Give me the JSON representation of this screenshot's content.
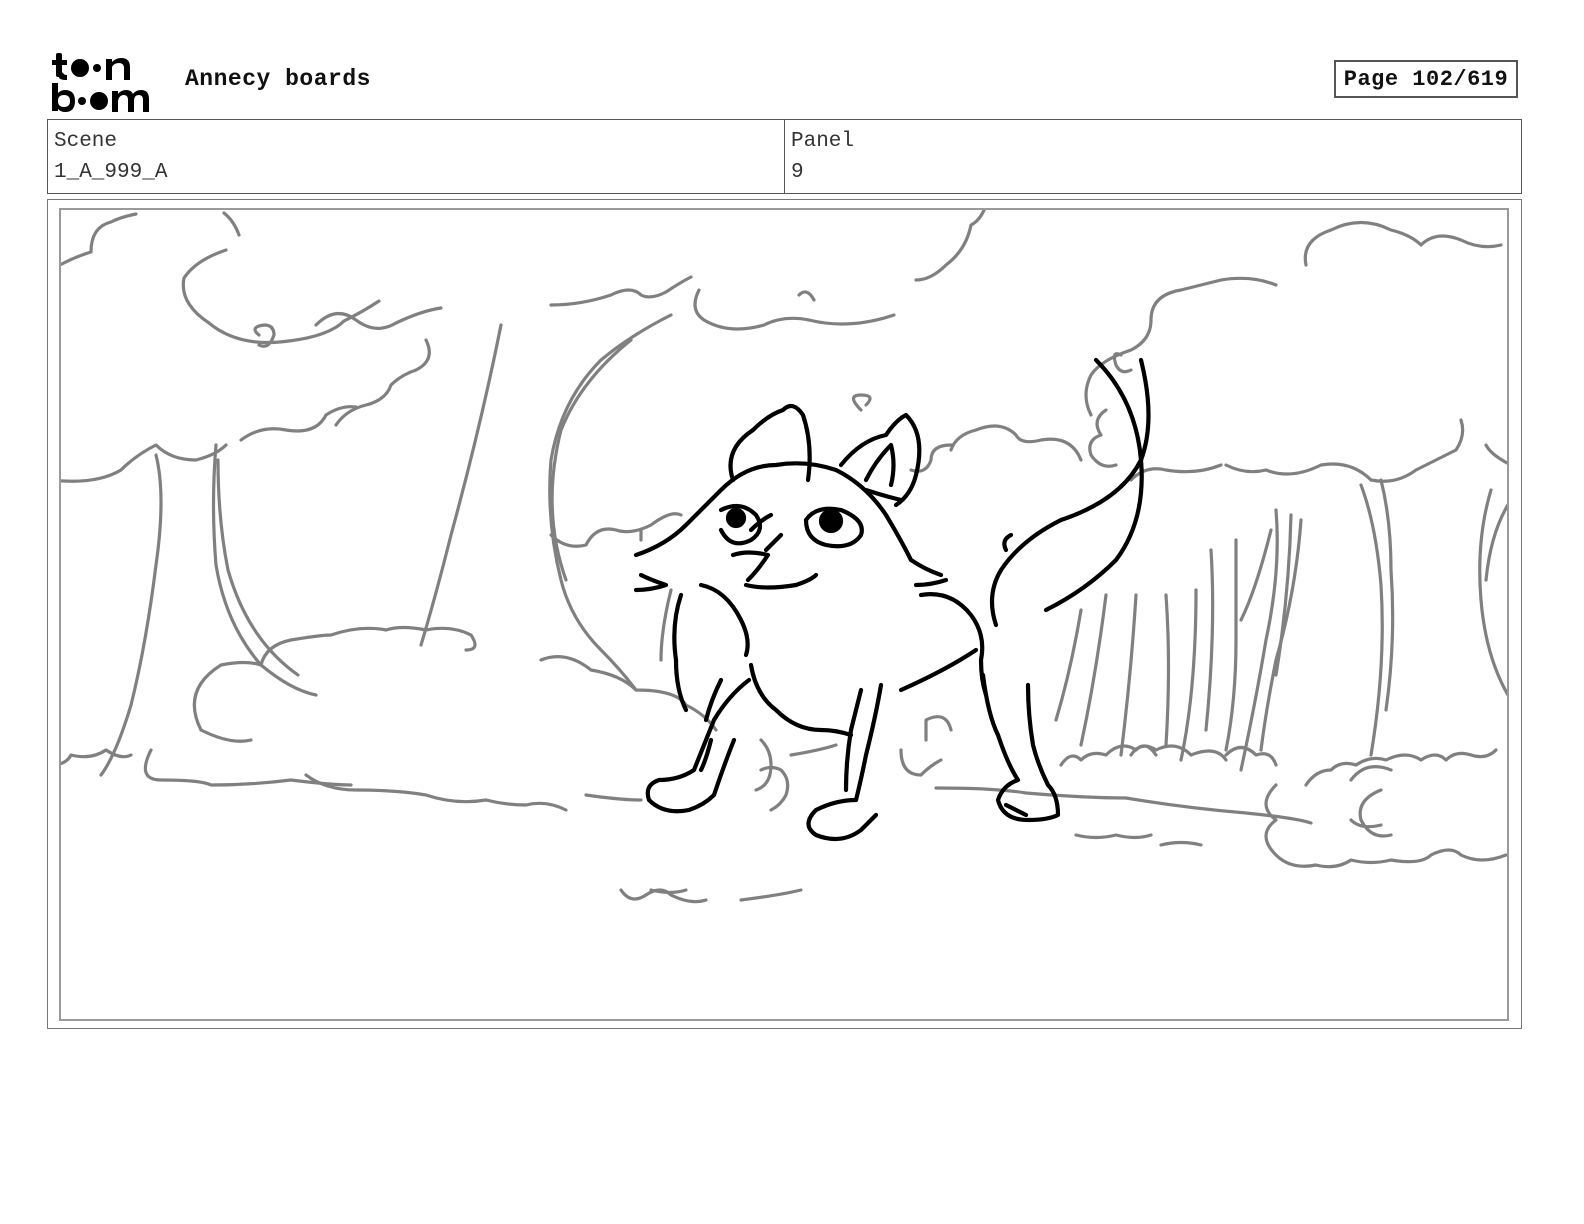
{
  "header": {
    "logo_text": "toon boom",
    "project_title": "Annecy boards",
    "page_indicator": "Page 102/619"
  },
  "info": {
    "scene_label": "Scene",
    "scene_value": "1_A_999_A",
    "panel_label": "Panel",
    "panel_value": "9"
  },
  "panel_image": {
    "description_icon": "storyboard-sketch-fox-in-forest",
    "line_color_foreground": "#000000",
    "line_color_background": "#808080"
  }
}
